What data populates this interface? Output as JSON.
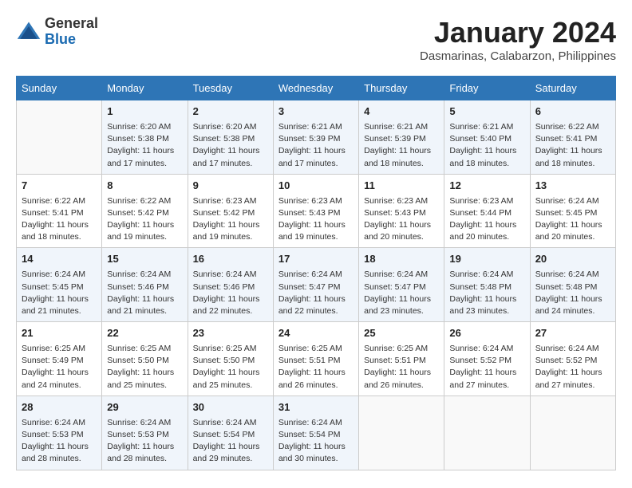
{
  "header": {
    "logo_general": "General",
    "logo_blue": "Blue",
    "month_title": "January 2024",
    "location": "Dasmarinas, Calabarzon, Philippines"
  },
  "weekdays": [
    "Sunday",
    "Monday",
    "Tuesday",
    "Wednesday",
    "Thursday",
    "Friday",
    "Saturday"
  ],
  "weeks": [
    [
      {
        "day": "",
        "sunrise": "",
        "sunset": "",
        "daylight": ""
      },
      {
        "day": "1",
        "sunrise": "Sunrise: 6:20 AM",
        "sunset": "Sunset: 5:38 PM",
        "daylight": "Daylight: 11 hours and 17 minutes."
      },
      {
        "day": "2",
        "sunrise": "Sunrise: 6:20 AM",
        "sunset": "Sunset: 5:38 PM",
        "daylight": "Daylight: 11 hours and 17 minutes."
      },
      {
        "day": "3",
        "sunrise": "Sunrise: 6:21 AM",
        "sunset": "Sunset: 5:39 PM",
        "daylight": "Daylight: 11 hours and 17 minutes."
      },
      {
        "day": "4",
        "sunrise": "Sunrise: 6:21 AM",
        "sunset": "Sunset: 5:39 PM",
        "daylight": "Daylight: 11 hours and 18 minutes."
      },
      {
        "day": "5",
        "sunrise": "Sunrise: 6:21 AM",
        "sunset": "Sunset: 5:40 PM",
        "daylight": "Daylight: 11 hours and 18 minutes."
      },
      {
        "day": "6",
        "sunrise": "Sunrise: 6:22 AM",
        "sunset": "Sunset: 5:41 PM",
        "daylight": "Daylight: 11 hours and 18 minutes."
      }
    ],
    [
      {
        "day": "7",
        "sunrise": "Sunrise: 6:22 AM",
        "sunset": "Sunset: 5:41 PM",
        "daylight": "Daylight: 11 hours and 18 minutes."
      },
      {
        "day": "8",
        "sunrise": "Sunrise: 6:22 AM",
        "sunset": "Sunset: 5:42 PM",
        "daylight": "Daylight: 11 hours and 19 minutes."
      },
      {
        "day": "9",
        "sunrise": "Sunrise: 6:23 AM",
        "sunset": "Sunset: 5:42 PM",
        "daylight": "Daylight: 11 hours and 19 minutes."
      },
      {
        "day": "10",
        "sunrise": "Sunrise: 6:23 AM",
        "sunset": "Sunset: 5:43 PM",
        "daylight": "Daylight: 11 hours and 19 minutes."
      },
      {
        "day": "11",
        "sunrise": "Sunrise: 6:23 AM",
        "sunset": "Sunset: 5:43 PM",
        "daylight": "Daylight: 11 hours and 20 minutes."
      },
      {
        "day": "12",
        "sunrise": "Sunrise: 6:23 AM",
        "sunset": "Sunset: 5:44 PM",
        "daylight": "Daylight: 11 hours and 20 minutes."
      },
      {
        "day": "13",
        "sunrise": "Sunrise: 6:24 AM",
        "sunset": "Sunset: 5:45 PM",
        "daylight": "Daylight: 11 hours and 20 minutes."
      }
    ],
    [
      {
        "day": "14",
        "sunrise": "Sunrise: 6:24 AM",
        "sunset": "Sunset: 5:45 PM",
        "daylight": "Daylight: 11 hours and 21 minutes."
      },
      {
        "day": "15",
        "sunrise": "Sunrise: 6:24 AM",
        "sunset": "Sunset: 5:46 PM",
        "daylight": "Daylight: 11 hours and 21 minutes."
      },
      {
        "day": "16",
        "sunrise": "Sunrise: 6:24 AM",
        "sunset": "Sunset: 5:46 PM",
        "daylight": "Daylight: 11 hours and 22 minutes."
      },
      {
        "day": "17",
        "sunrise": "Sunrise: 6:24 AM",
        "sunset": "Sunset: 5:47 PM",
        "daylight": "Daylight: 11 hours and 22 minutes."
      },
      {
        "day": "18",
        "sunrise": "Sunrise: 6:24 AM",
        "sunset": "Sunset: 5:47 PM",
        "daylight": "Daylight: 11 hours and 23 minutes."
      },
      {
        "day": "19",
        "sunrise": "Sunrise: 6:24 AM",
        "sunset": "Sunset: 5:48 PM",
        "daylight": "Daylight: 11 hours and 23 minutes."
      },
      {
        "day": "20",
        "sunrise": "Sunrise: 6:24 AM",
        "sunset": "Sunset: 5:48 PM",
        "daylight": "Daylight: 11 hours and 24 minutes."
      }
    ],
    [
      {
        "day": "21",
        "sunrise": "Sunrise: 6:25 AM",
        "sunset": "Sunset: 5:49 PM",
        "daylight": "Daylight: 11 hours and 24 minutes."
      },
      {
        "day": "22",
        "sunrise": "Sunrise: 6:25 AM",
        "sunset": "Sunset: 5:50 PM",
        "daylight": "Daylight: 11 hours and 25 minutes."
      },
      {
        "day": "23",
        "sunrise": "Sunrise: 6:25 AM",
        "sunset": "Sunset: 5:50 PM",
        "daylight": "Daylight: 11 hours and 25 minutes."
      },
      {
        "day": "24",
        "sunrise": "Sunrise: 6:25 AM",
        "sunset": "Sunset: 5:51 PM",
        "daylight": "Daylight: 11 hours and 26 minutes."
      },
      {
        "day": "25",
        "sunrise": "Sunrise: 6:25 AM",
        "sunset": "Sunset: 5:51 PM",
        "daylight": "Daylight: 11 hours and 26 minutes."
      },
      {
        "day": "26",
        "sunrise": "Sunrise: 6:24 AM",
        "sunset": "Sunset: 5:52 PM",
        "daylight": "Daylight: 11 hours and 27 minutes."
      },
      {
        "day": "27",
        "sunrise": "Sunrise: 6:24 AM",
        "sunset": "Sunset: 5:52 PM",
        "daylight": "Daylight: 11 hours and 27 minutes."
      }
    ],
    [
      {
        "day": "28",
        "sunrise": "Sunrise: 6:24 AM",
        "sunset": "Sunset: 5:53 PM",
        "daylight": "Daylight: 11 hours and 28 minutes."
      },
      {
        "day": "29",
        "sunrise": "Sunrise: 6:24 AM",
        "sunset": "Sunset: 5:53 PM",
        "daylight": "Daylight: 11 hours and 28 minutes."
      },
      {
        "day": "30",
        "sunrise": "Sunrise: 6:24 AM",
        "sunset": "Sunset: 5:54 PM",
        "daylight": "Daylight: 11 hours and 29 minutes."
      },
      {
        "day": "31",
        "sunrise": "Sunrise: 6:24 AM",
        "sunset": "Sunset: 5:54 PM",
        "daylight": "Daylight: 11 hours and 30 minutes."
      },
      {
        "day": "",
        "sunrise": "",
        "sunset": "",
        "daylight": ""
      },
      {
        "day": "",
        "sunrise": "",
        "sunset": "",
        "daylight": ""
      },
      {
        "day": "",
        "sunrise": "",
        "sunset": "",
        "daylight": ""
      }
    ]
  ]
}
